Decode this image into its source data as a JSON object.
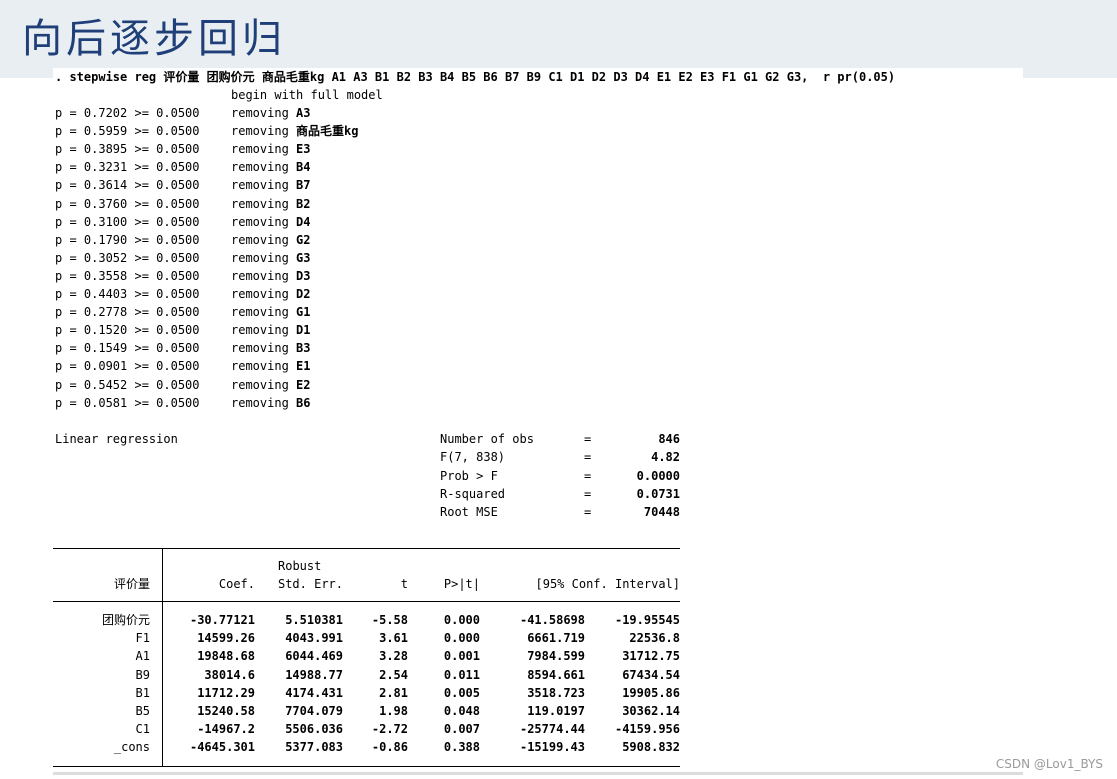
{
  "title": "向后逐步回归",
  "command": {
    "prompt": ". stepwise reg",
    "vars_cn_1": "评价量",
    "vars_cn_2": "团购价元",
    "vars_cn_3": "商品毛重",
    "rest": "kg A1 A3 B1 B2 B3 B4 B5 B6 B7 B9 C1 D1 D2 D3 D4 E1 E2 E3 F1 G1 G2 G3,  r pr(0.05)"
  },
  "begin_text": "begin with full model",
  "steps": [
    {
      "p": "p = 0.7202 >= 0.0500",
      "action": "removing",
      "var": "A3",
      "var_cn": ""
    },
    {
      "p": "p = 0.5959 >= 0.0500",
      "action": "removing",
      "var": "kg",
      "var_cn": "商品毛重"
    },
    {
      "p": "p = 0.3895 >= 0.0500",
      "action": "removing",
      "var": "E3",
      "var_cn": ""
    },
    {
      "p": "p = 0.3231 >= 0.0500",
      "action": "removing",
      "var": "B4",
      "var_cn": ""
    },
    {
      "p": "p = 0.3614 >= 0.0500",
      "action": "removing",
      "var": "B7",
      "var_cn": ""
    },
    {
      "p": "p = 0.3760 >= 0.0500",
      "action": "removing",
      "var": "B2",
      "var_cn": ""
    },
    {
      "p": "p = 0.3100 >= 0.0500",
      "action": "removing",
      "var": "D4",
      "var_cn": ""
    },
    {
      "p": "p = 0.1790 >= 0.0500",
      "action": "removing",
      "var": "G2",
      "var_cn": ""
    },
    {
      "p": "p = 0.3052 >= 0.0500",
      "action": "removing",
      "var": "G3",
      "var_cn": ""
    },
    {
      "p": "p = 0.3558 >= 0.0500",
      "action": "removing",
      "var": "D3",
      "var_cn": ""
    },
    {
      "p": "p = 0.4403 >= 0.0500",
      "action": "removing",
      "var": "D2",
      "var_cn": ""
    },
    {
      "p": "p = 0.2778 >= 0.0500",
      "action": "removing",
      "var": "G1",
      "var_cn": ""
    },
    {
      "p": "p = 0.1520 >= 0.0500",
      "action": "removing",
      "var": "D1",
      "var_cn": ""
    },
    {
      "p": "p = 0.1549 >= 0.0500",
      "action": "removing",
      "var": "B3",
      "var_cn": ""
    },
    {
      "p": "p = 0.0901 >= 0.0500",
      "action": "removing",
      "var": "E1",
      "var_cn": ""
    },
    {
      "p": "p = 0.5452 >= 0.0500",
      "action": "removing",
      "var": "E2",
      "var_cn": ""
    },
    {
      "p": "p = 0.0581 >= 0.0500",
      "action": "removing",
      "var": "B6",
      "var_cn": ""
    }
  ],
  "model_label": "Linear regression",
  "stats": [
    {
      "label": "Number of obs",
      "eq": "=",
      "value": "846"
    },
    {
      "label": "F(7, 838)",
      "eq": "=",
      "value": "4.82"
    },
    {
      "label": "Prob > F",
      "eq": "=",
      "value": "0.0000"
    },
    {
      "label": "R-squared",
      "eq": "=",
      "value": "0.0731"
    },
    {
      "label": "Root MSE",
      "eq": "=",
      "value": "70448"
    }
  ],
  "table": {
    "dep_var": "评价量",
    "robust_label": "Robust",
    "headers": {
      "coef": "Coef.",
      "se": "Std. Err.",
      "t": "t",
      "p": "P>|t|",
      "ci": "[95% Conf. Interval]"
    },
    "rows": [
      {
        "name": "团购价元",
        "coef": "-30.77121",
        "se": "5.510381",
        "t": "-5.58",
        "p": "0.000",
        "lo": "-41.58698",
        "hi": "-19.95545"
      },
      {
        "name": "F1",
        "coef": "14599.26",
        "se": "4043.991",
        "t": "3.61",
        "p": "0.000",
        "lo": "6661.719",
        "hi": "22536.8"
      },
      {
        "name": "A1",
        "coef": "19848.68",
        "se": "6044.469",
        "t": "3.28",
        "p": "0.001",
        "lo": "7984.599",
        "hi": "31712.75"
      },
      {
        "name": "B9",
        "coef": "38014.6",
        "se": "14988.77",
        "t": "2.54",
        "p": "0.011",
        "lo": "8594.661",
        "hi": "67434.54"
      },
      {
        "name": "B1",
        "coef": "11712.29",
        "se": "4174.431",
        "t": "2.81",
        "p": "0.005",
        "lo": "3518.723",
        "hi": "19905.86"
      },
      {
        "name": "B5",
        "coef": "15240.58",
        "se": "7704.079",
        "t": "1.98",
        "p": "0.048",
        "lo": "119.0197",
        "hi": "30362.14"
      },
      {
        "name": "C1",
        "coef": "-14967.2",
        "se": "5506.036",
        "t": "-2.72",
        "p": "0.007",
        "lo": "-25774.44",
        "hi": "-4159.956"
      },
      {
        "name": "_cons",
        "coef": "-4645.301",
        "se": "5377.083",
        "t": "-0.86",
        "p": "0.388",
        "lo": "-15199.43",
        "hi": "5908.832"
      }
    ]
  },
  "watermark": "CSDN @Lov1_BYS"
}
